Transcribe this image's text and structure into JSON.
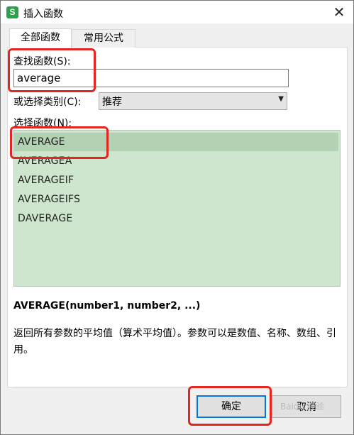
{
  "window": {
    "title": "插入函数",
    "app_icon_letter": "S",
    "close_glyph": "✕"
  },
  "tabs": [
    {
      "label": "全部函数",
      "active": true
    },
    {
      "label": "常用公式",
      "active": false
    }
  ],
  "search": {
    "label": "查找函数(S):",
    "value": "average"
  },
  "category": {
    "label": "或选择类别(C):",
    "selected": "推荐"
  },
  "function_list": {
    "label": "选择函数(N):",
    "items": [
      "AVERAGE",
      "AVERAGEA",
      "AVERAGEIF",
      "AVERAGEIFS",
      "DAVERAGE"
    ],
    "selected_index": 0
  },
  "details": {
    "signature": "AVERAGE(number1, number2, ...)",
    "description": "返回所有参数的平均值（算术平均值）。参数可以是数值、名称、数组、引用。"
  },
  "buttons": {
    "ok": "确定",
    "cancel": "取消"
  },
  "watermark": "Baidu 经验",
  "colors": {
    "highlight": "#e52620",
    "list_bg": "#cde6cd",
    "selected_row": "#b3d1b3",
    "app_icon": "#2aa24a"
  }
}
